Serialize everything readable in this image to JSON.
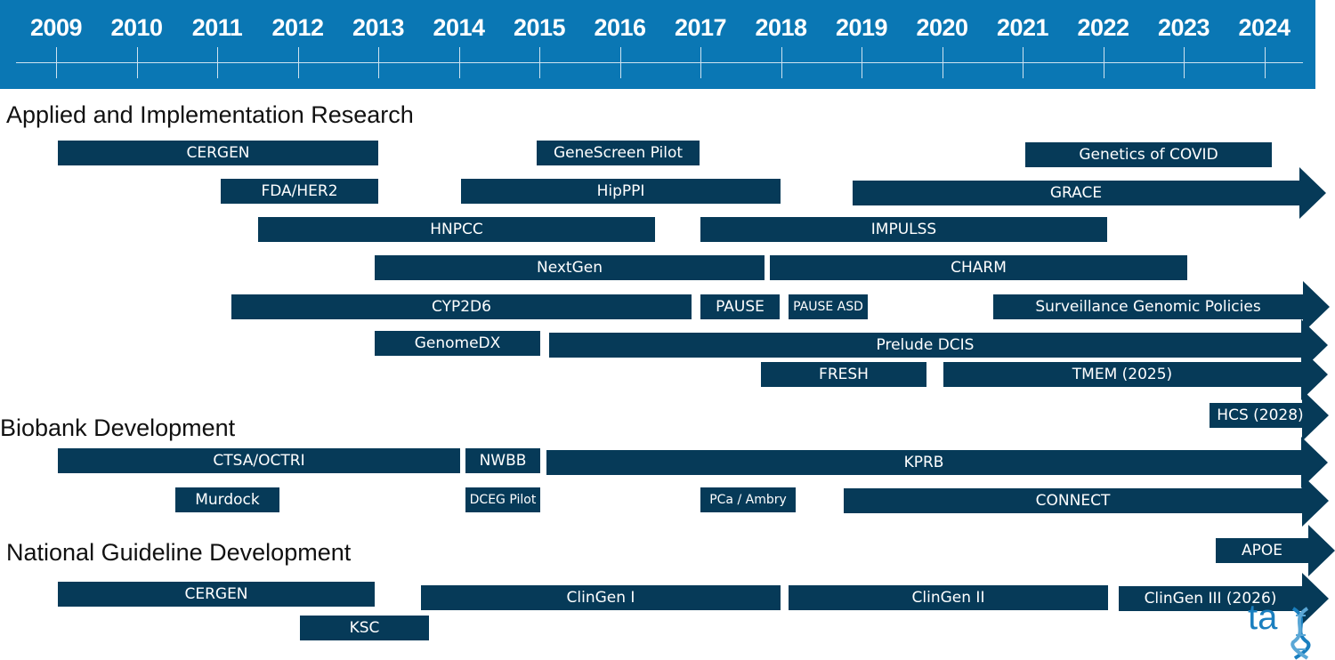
{
  "timeline": {
    "years": [
      "2009",
      "2010",
      "2011",
      "2012",
      "2013",
      "2014",
      "2015",
      "2016",
      "2017",
      "2018",
      "2019",
      "2020",
      "2021",
      "2022",
      "2023",
      "2024"
    ]
  },
  "colors": {
    "header": "#0a77b4",
    "bar": "#063a58",
    "logo": "#1a7fbf"
  },
  "sections": {
    "applied": "Applied and Implementation Research",
    "biobank": "Biobank Development",
    "guideline": "National Guideline Development"
  },
  "bars": {
    "cergen1": "CERGEN",
    "genescreen": "GeneScreen Pilot",
    "covid": "Genetics of COVID",
    "fda": "FDA/HER2",
    "hipppi": "HipPPI",
    "grace": "GRACE",
    "hnpcc": "HNPCC",
    "impulss": "IMPULSS",
    "nextgen": "NextGen",
    "charm": "CHARM",
    "cyp2d6": "CYP2D6",
    "pause": "PAUSE",
    "pauseasd": "PAUSE ASD",
    "surveillance": "Surveillance Genomic Policies",
    "genomedx": "GenomeDX",
    "prelude": "Prelude DCIS",
    "fresh": "FRESH",
    "tmem": "TMEM (2025)",
    "hcs": "HCS (2028)",
    "ctsa": "CTSA/OCTRI",
    "nwbb": "NWBB",
    "kprb": "KPRB",
    "murdock": "Murdock",
    "dceg": "DCEG Pilot",
    "pca": "PCa / Ambry",
    "connect": "CONNECT",
    "apoe": "APOE",
    "cergen2": "CERGEN",
    "ksc": "KSC",
    "clingen1": "ClinGen I",
    "clingen2": "ClinGen II",
    "clingen3": "ClinGen III (2026)"
  },
  "logo": {
    "text": "tag",
    "icon": "dna-icon"
  }
}
